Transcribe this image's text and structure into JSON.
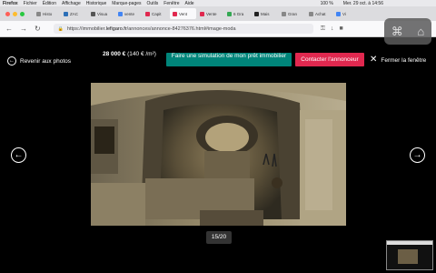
{
  "os_menubar": {
    "app": "Firefox",
    "items": [
      "Fichier",
      "Édition",
      "Affichage",
      "Historique",
      "Marque-pages",
      "Outils",
      "Fenêtre",
      "Aide"
    ],
    "battery": "100 %",
    "datetime": "Mer. 29 oct. à 14:56"
  },
  "tabs": [
    {
      "label": "Histo",
      "color": "#888888"
    },
    {
      "label": "ZAC",
      "color": "#2c6fb7"
    },
    {
      "label": "Visua",
      "color": "#555555"
    },
    {
      "label": "vente",
      "color": "#4285f4"
    },
    {
      "label": "Capit",
      "color": "#e0284f"
    },
    {
      "label": "Vent",
      "color": "#e0284f",
      "active": true
    },
    {
      "label": "Vente",
      "color": "#e0284f"
    },
    {
      "label": "6 Gra",
      "color": "#34a853"
    },
    {
      "label": "Mais",
      "color": "#222222"
    },
    {
      "label": "Gran",
      "color": "#888888"
    },
    {
      "label": "Achat",
      "color": "#888888"
    },
    {
      "label": "Vi",
      "color": "#4285f4"
    }
  ],
  "browser": {
    "url_prefix": "https://immobilier.",
    "url_domain": "lefigaro.fr",
    "url_rest": "/annonces/annonce-84276376.html#image-moda"
  },
  "viewer": {
    "back_label": "Revenir aux photos",
    "price": "28 000 €",
    "price_per_m2": "(140 € /m²)",
    "simulate_label": "Faire une simulation de mon prêt immobilier",
    "contact_label": "Contacter l'annonceur",
    "close_label": "Fermer la fenêtre",
    "counter": "15/20",
    "colors": {
      "simulate": "#00857a",
      "contact": "#e0284f"
    }
  },
  "icons": {
    "back": "arrow-left-circle-icon",
    "close": "close-icon",
    "prev": "chevron-left-circle-icon",
    "next": "chevron-right-circle-icon"
  }
}
